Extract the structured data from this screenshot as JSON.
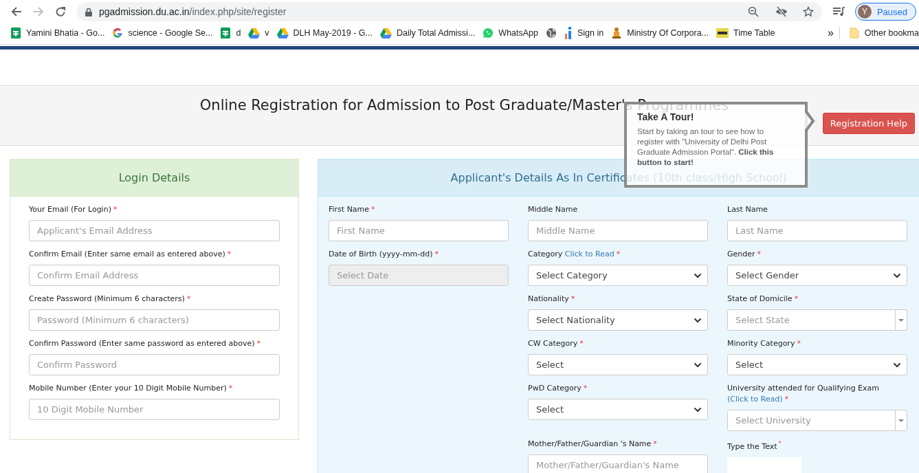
{
  "browser": {
    "url_domain": "pgadmission.du.ac.in",
    "url_path": "/index.php/site/register",
    "profile": {
      "avatar_letter": "Y",
      "status": "Paused"
    },
    "bookmarks": [
      {
        "kind": "sheet",
        "label": "Yamini Bhatia - Go..."
      },
      {
        "kind": "google",
        "label": "science - Google Se..."
      },
      {
        "kind": "sheet",
        "label": "d"
      },
      {
        "kind": "drive",
        "label": "v"
      },
      {
        "kind": "drive",
        "label": "DLH May-2019 - G..."
      },
      {
        "kind": "drive",
        "label": "Daily Total Admissi..."
      },
      {
        "kind": "chat",
        "label": "WhatsApp"
      },
      {
        "kind": "globe"
      },
      {
        "kind": "bars",
        "label": "Sign in"
      },
      {
        "kind": "emblem",
        "label": "Ministry Of Corpora..."
      },
      {
        "kind": "thumb",
        "label": "Time Table"
      }
    ],
    "overflow": "»",
    "other_bookmarks": "Other bookma"
  },
  "header": {
    "title": "Online Registration for Admission to Post Graduate/Master's Programmes",
    "help_button": "Registration Help"
  },
  "tour": {
    "title": "Take A Tour!",
    "body": "Start by taking an tour to see how to register with \"University of Delhi Post Graduate Admission Portal\". **Click this button to start!**"
  },
  "login_details": {
    "title": "Login Details",
    "fields": [
      {
        "label": "Your Email (For Login)",
        "required_mark": "*",
        "placeholder": "Applicant's Email Address"
      },
      {
        "label": "Confirm Email (Enter same email as entered above)",
        "required_mark": "*",
        "placeholder": "Confirm Email Address"
      },
      {
        "label": "Create Password (Minimum 6 characters)",
        "required_mark": "*",
        "placeholder": "Password (Minimum 6 characters)"
      },
      {
        "label": "Confirm Password (Enter same password as entered above)",
        "required_mark": "*",
        "placeholder": "Confirm Password"
      },
      {
        "label": "Mobile Number (Enter your 10 Digit Mobile Number)",
        "required_mark": "*",
        "placeholder": "10 Digit Mobile Number"
      }
    ]
  },
  "applicant_details": {
    "title": "Applicant's Details As In Certificates (10th class/High School)",
    "rows": [
      [
        {
          "kind": "input",
          "label": "First Name",
          "required_mark": "*",
          "placeholder": "First Name"
        },
        {
          "kind": "input",
          "label": "Middle Name",
          "placeholder": "Middle Name"
        },
        {
          "kind": "input",
          "label": "Last Name",
          "placeholder": "Last Name"
        }
      ],
      [
        {
          "kind": "date",
          "label": "Date of Birth (yyyy-mm-dd)",
          "required_mark": "*",
          "placeholder": "Select Date"
        },
        {
          "kind": "select",
          "label": "Category",
          "link": "Click to Read",
          "required_mark": "*",
          "value": "Select Category"
        },
        {
          "kind": "select",
          "label": "Gender",
          "required_mark": "*",
          "value": "Select Gender"
        }
      ],
      [
        {
          "kind": "select",
          "label": "Nationality",
          "required_mark": "*",
          "value": "Select Nationality"
        },
        {
          "kind": "combo",
          "label": "State of Domicile",
          "required_mark": "*",
          "placeholder": "Select State"
        }
      ],
      [
        {
          "kind": "select",
          "label": "CW Category",
          "required_mark": "*",
          "value": "Select"
        },
        {
          "kind": "select",
          "label": "Minority Category",
          "required_mark": "*",
          "value": "Select"
        }
      ],
      [
        {
          "kind": "select",
          "label": "PwD Category",
          "required_mark": "*",
          "value": "Select"
        },
        {
          "kind": "combo",
          "label": "University attended for Qualifying Exam",
          "link": "(Click to Read)",
          "required_mark": "*",
          "placeholder": "Select University"
        }
      ],
      [
        {
          "kind": "input",
          "label": "Mother/Father/Guardian 's Name",
          "required_mark": "*",
          "placeholder": "Mother/Father/Guardian's Name"
        },
        {
          "kind": "captcha",
          "label": "Type the Text",
          "required_mark": "*"
        }
      ]
    ]
  }
}
